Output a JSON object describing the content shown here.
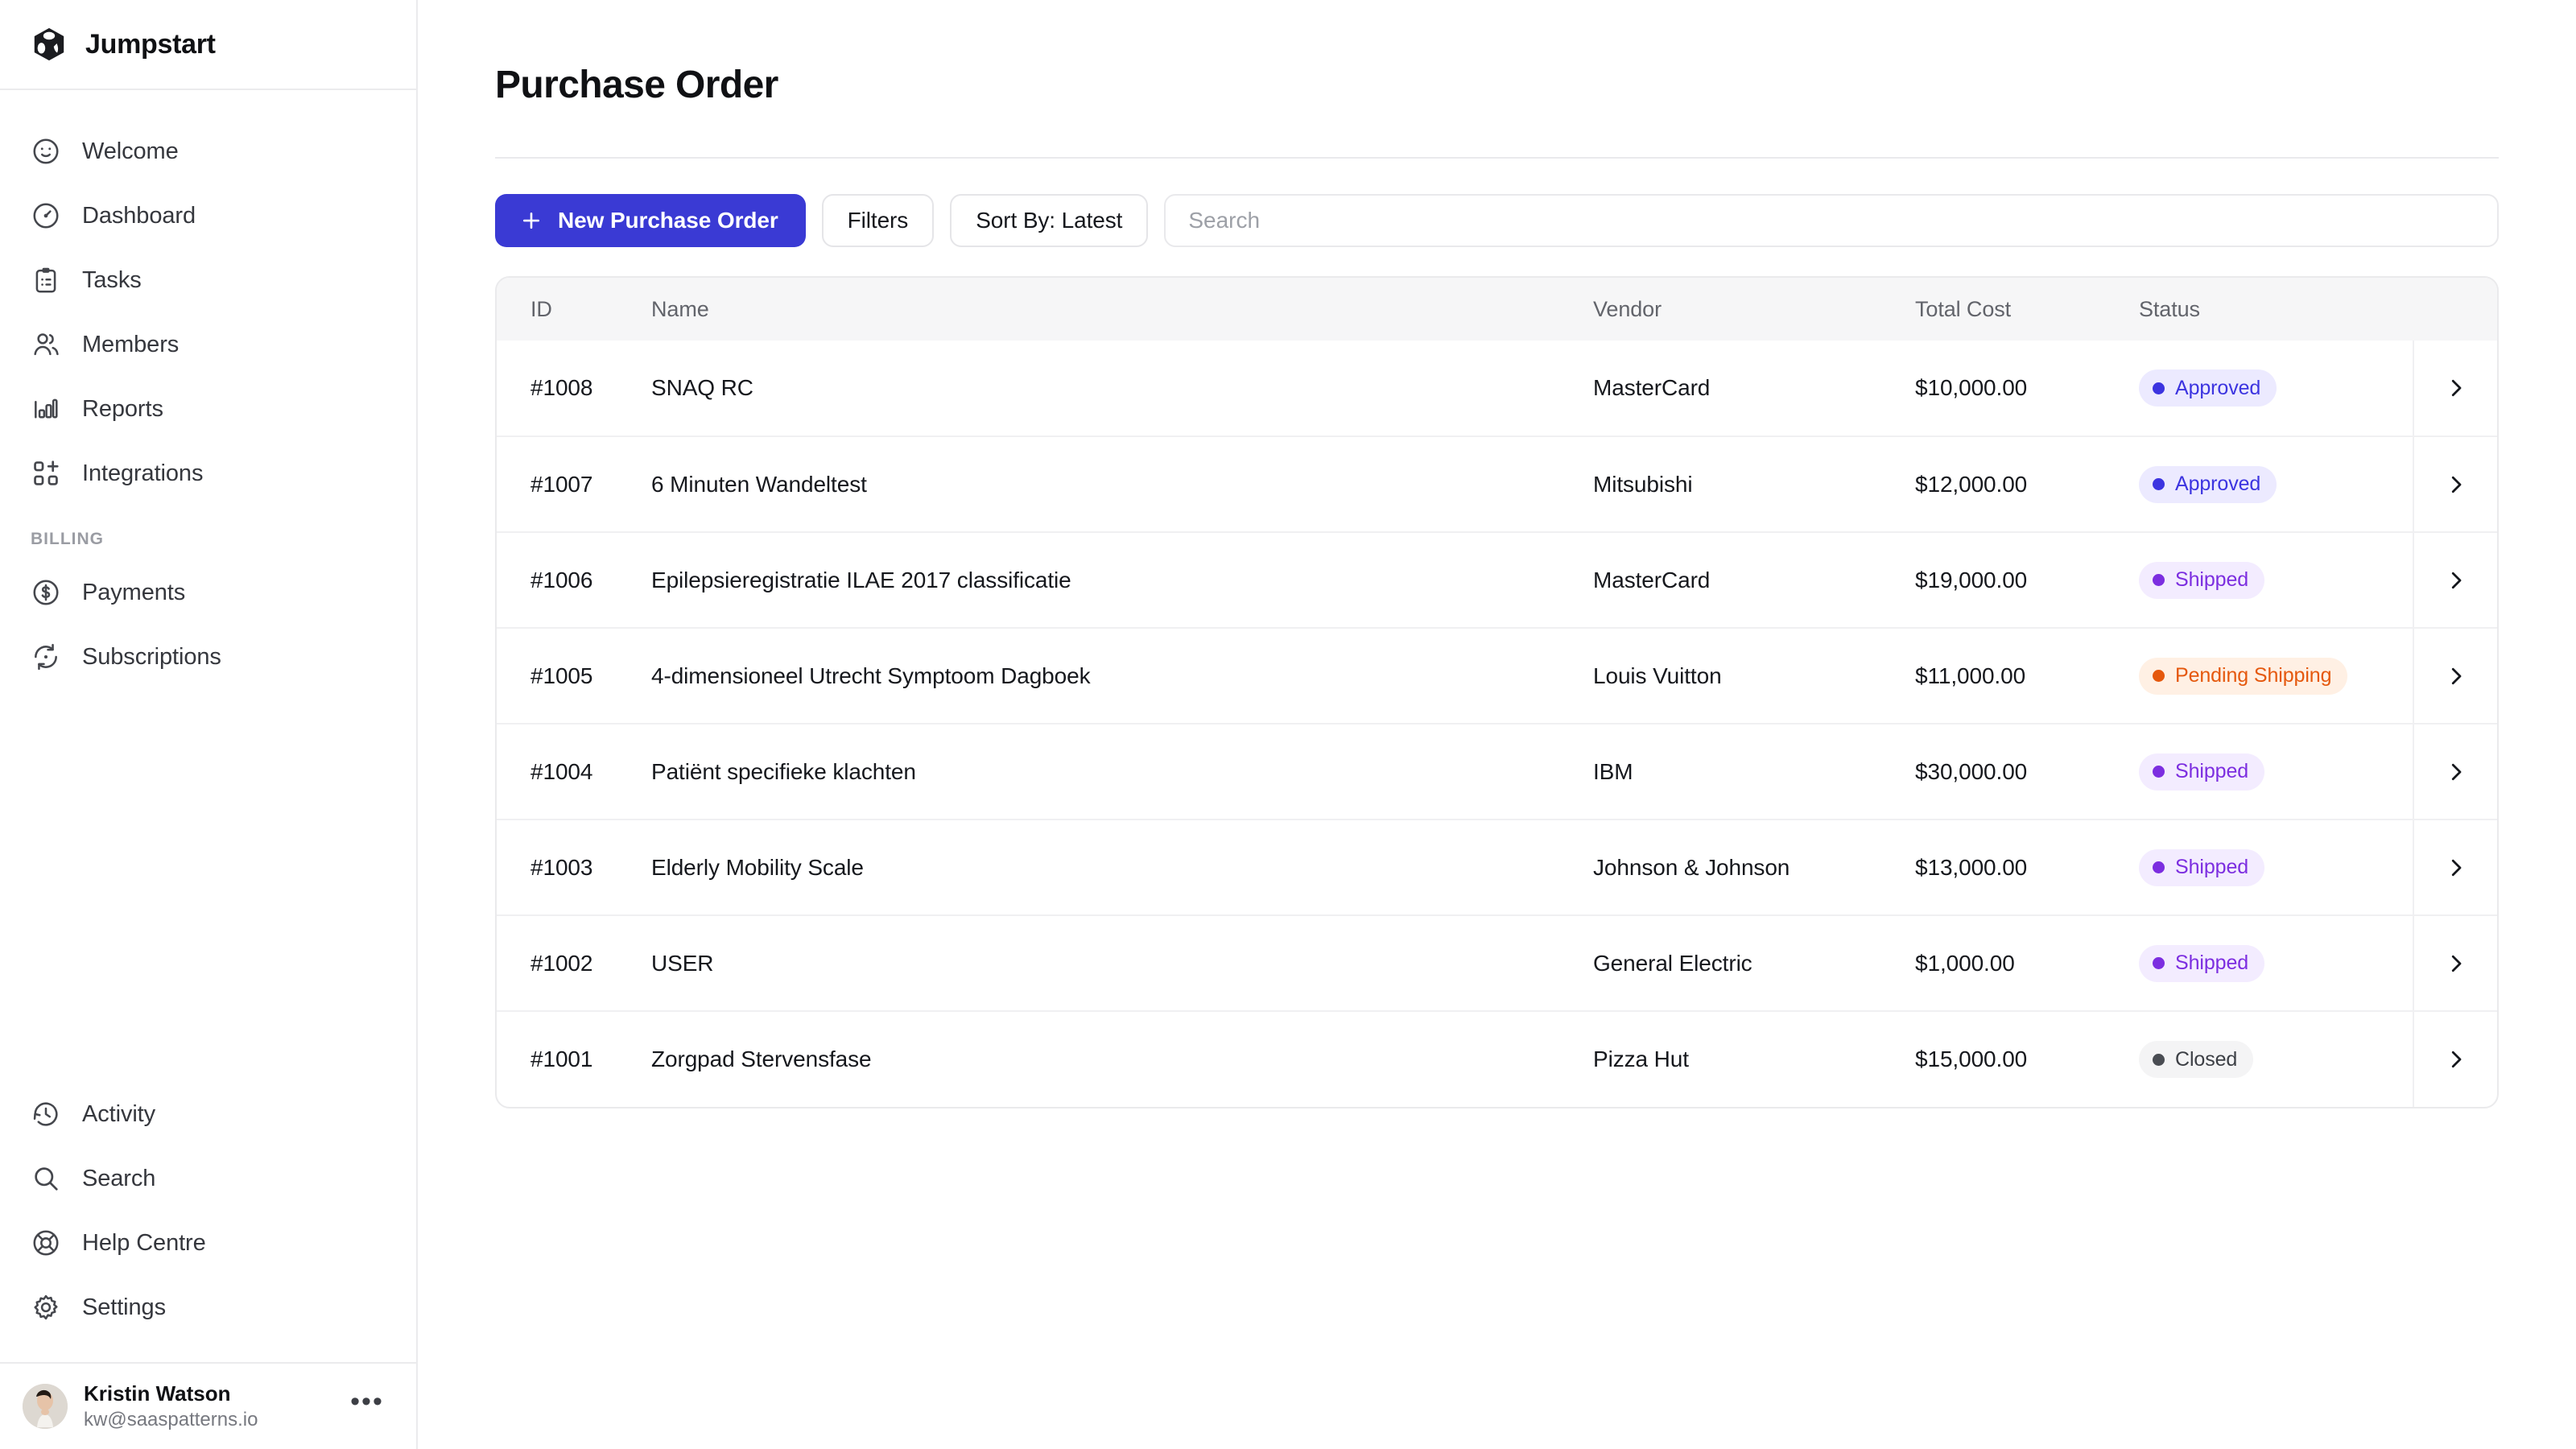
{
  "brand": {
    "name": "Jumpstart",
    "logo_icon": "cube-icon"
  },
  "sidebar": {
    "primary_items": [
      {
        "label": "Welcome",
        "icon": "smiley-face-icon"
      },
      {
        "label": "Dashboard",
        "icon": "gauge-icon"
      },
      {
        "label": "Tasks",
        "icon": "clipboard-icon"
      },
      {
        "label": "Members",
        "icon": "users-icon"
      },
      {
        "label": "Reports",
        "icon": "bar-chart-icon"
      },
      {
        "label": "Integrations",
        "icon": "grid-plus-icon"
      }
    ],
    "section_title": "BILLING",
    "billing_items": [
      {
        "label": "Payments",
        "icon": "dollar-circle-icon"
      },
      {
        "label": "Subscriptions",
        "icon": "refresh-cycle-icon"
      }
    ],
    "bottom_items": [
      {
        "label": "Activity",
        "icon": "clock-history-icon"
      },
      {
        "label": "Search",
        "icon": "search-icon"
      },
      {
        "label": "Help Centre",
        "icon": "lifebuoy-icon"
      },
      {
        "label": "Settings",
        "icon": "gear-icon"
      }
    ],
    "user": {
      "name": "Kristin Watson",
      "email": "kw@saaspatterns.io",
      "avatar_icon": "user-avatar-photo",
      "more_icon": "ellipsis-icon",
      "more_label": "•••"
    }
  },
  "main": {
    "title": "Purchase Order",
    "toolbar": {
      "new_button": {
        "label": "New Purchase Order",
        "icon": "plus-icon"
      },
      "filters_button": "Filters",
      "sort_button": "Sort By: Latest",
      "search": {
        "value": "",
        "placeholder": "Search"
      }
    },
    "table": {
      "columns": [
        "ID",
        "Name",
        "Vendor",
        "Total Cost",
        "Status"
      ],
      "row_action_icon": "chevron-right-icon",
      "rows": [
        {
          "id": "#1008",
          "name": "SNAQ RC",
          "vendor": "MasterCard",
          "cost": "$10,000.00",
          "status": "Approved",
          "status_key": "approved"
        },
        {
          "id": "#1007",
          "name": "6 Minuten Wandeltest",
          "vendor": "Mitsubishi",
          "cost": "$12,000.00",
          "status": "Approved",
          "status_key": "approved"
        },
        {
          "id": "#1006",
          "name": "Epilepsieregistratie ILAE 2017 classificatie",
          "vendor": "MasterCard",
          "cost": "$19,000.00",
          "status": "Shipped",
          "status_key": "shipped"
        },
        {
          "id": "#1005",
          "name": "4-dimensioneel Utrecht Symptoom Dagboek",
          "vendor": "Louis Vuitton",
          "cost": "$11,000.00",
          "status": "Pending Shipping",
          "status_key": "pending"
        },
        {
          "id": "#1004",
          "name": "Patiënt specifieke klachten",
          "vendor": "IBM",
          "cost": "$30,000.00",
          "status": "Shipped",
          "status_key": "shipped"
        },
        {
          "id": "#1003",
          "name": "Elderly Mobility Scale",
          "vendor": "Johnson & Johnson",
          "cost": "$13,000.00",
          "status": "Shipped",
          "status_key": "shipped"
        },
        {
          "id": "#1002",
          "name": "USER",
          "vendor": "General Electric",
          "cost": "$1,000.00",
          "status": "Shipped",
          "status_key": "shipped"
        },
        {
          "id": "#1001",
          "name": "Zorgpad Stervensfase",
          "vendor": "Pizza Hut",
          "cost": "$15,000.00",
          "status": "Closed",
          "status_key": "closed"
        }
      ]
    }
  },
  "colors": {
    "accent": "#3a3ad4",
    "approved": "#3c34e0",
    "shipped": "#7c2ee0",
    "pending": "#e5580d",
    "closed": "#4a4d53",
    "border": "#eaeaec",
    "header_bg": "#f6f6f7"
  }
}
